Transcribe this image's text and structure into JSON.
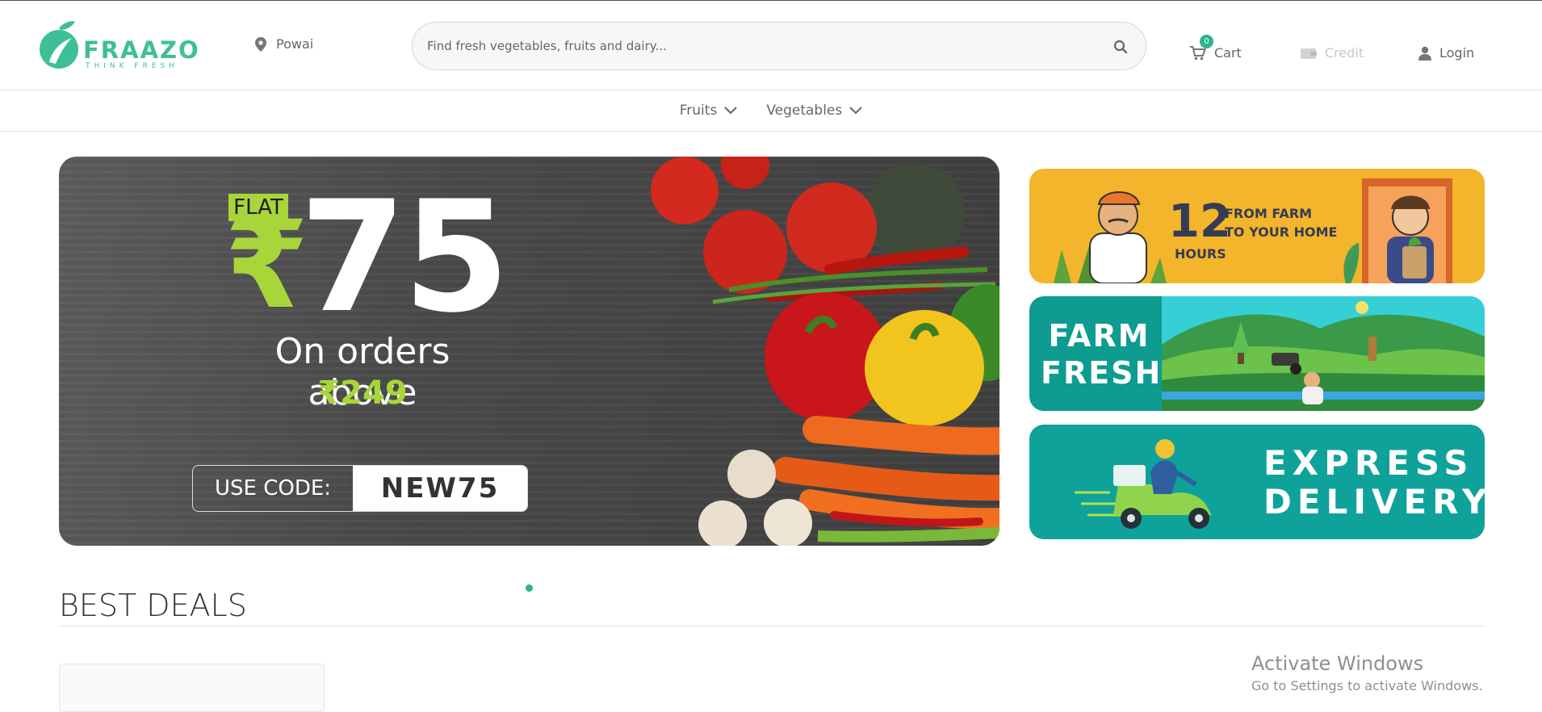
{
  "brand": {
    "name": "FRAAZO",
    "tagline": "THINK FRESH",
    "color": "#3fbf97"
  },
  "header": {
    "location": "Powai",
    "search_placeholder": "Find fresh vegetables, fruits and dairy...",
    "cart_label": "Cart",
    "cart_count": "0",
    "credit_label": "Credit",
    "login_label": "Login"
  },
  "nav": [
    {
      "label": "Fruits"
    },
    {
      "label": "Vegetables"
    }
  ],
  "hero": {
    "flat": "FLAT",
    "currency": "₹",
    "discount": "75",
    "subtitle": "On orders above",
    "min_order": "₹249",
    "code_label": "USE CODE:",
    "code_value": "NEW75"
  },
  "side_banners": {
    "farm_to_home": {
      "number": "12",
      "unit": "HOURS",
      "line1": "FROM FARM",
      "line2": "TO YOUR HOME"
    },
    "farm_fresh": {
      "line1": "FARM",
      "line2": "FRESH"
    },
    "express": {
      "line1": "EXPRESS",
      "line2": "DELIVERY"
    }
  },
  "section": {
    "title": "BEST DEALS"
  },
  "watermark": {
    "title": "Activate Windows",
    "subtitle": "Go to Settings to activate Windows."
  }
}
